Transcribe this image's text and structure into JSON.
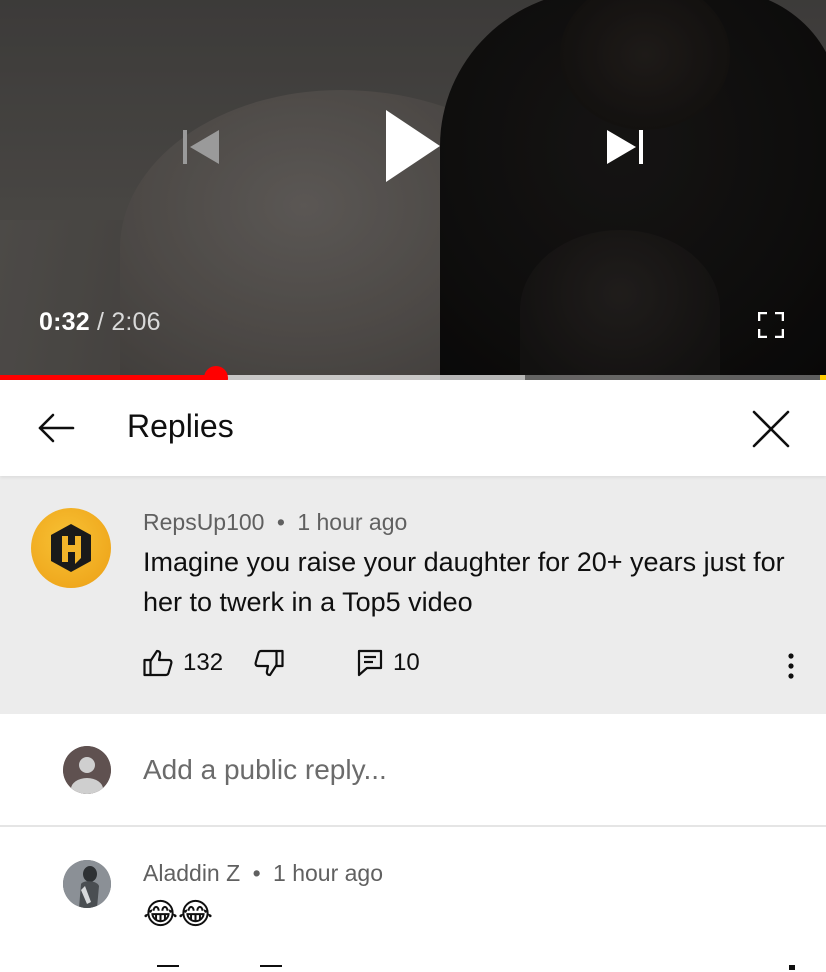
{
  "player": {
    "current_time": "0:32",
    "separator": "/",
    "duration": "2:06",
    "played_fraction": 0.262,
    "buffered_fraction": 0.636,
    "accent_color": "#ff0000",
    "icons": [
      "previous-icon",
      "play-icon",
      "next-icon",
      "fullscreen-icon"
    ]
  },
  "replies_panel": {
    "title": "Replies",
    "icons": [
      "back-arrow-icon",
      "close-icon"
    ]
  },
  "parent_comment": {
    "author": "RepsUp100",
    "dot": "•",
    "time": "1 hour ago",
    "text": "Imagine you raise your daughter for 20+ years just for her to twerk in a Top5 video",
    "likes": "132",
    "replies": "10",
    "icons": [
      "thumbs-up-icon",
      "thumbs-down-icon",
      "reply-icon",
      "more-vert-icon"
    ]
  },
  "add_reply": {
    "placeholder": "Add a public reply..."
  },
  "replies": [
    {
      "author": "Aladdin Z",
      "dot": "•",
      "time": "1 hour ago",
      "text": "😂😂"
    }
  ]
}
